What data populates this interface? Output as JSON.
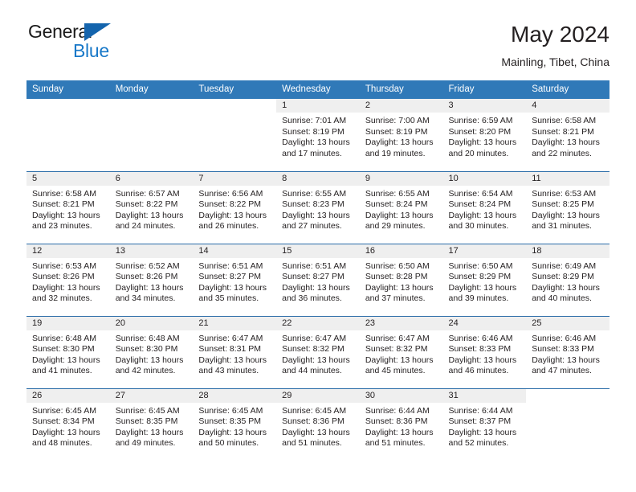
{
  "brand": {
    "name_top": "General",
    "name_bottom": "Blue",
    "color_dark": "#1a1a1a",
    "color_blue": "#1878c8",
    "triangle_color": "#1464ad"
  },
  "header": {
    "title": "May 2024",
    "subtitle": "Mainling, Tibet, China"
  },
  "theme": {
    "header_bg": "#3079b8",
    "row_divider": "#2a6ca8",
    "daynum_band_bg": "#efefef",
    "text": "#231f20"
  },
  "weekday_headers": [
    "Sunday",
    "Monday",
    "Tuesday",
    "Wednesday",
    "Thursday",
    "Friday",
    "Saturday"
  ],
  "labels": {
    "sunrise_prefix": "Sunrise:",
    "sunset_prefix": "Sunset:",
    "daylight_prefix": "Daylight:"
  },
  "weeks": [
    [
      {
        "day": "",
        "empty": true
      },
      {
        "day": "",
        "empty": true
      },
      {
        "day": "",
        "empty": true
      },
      {
        "day": "1",
        "sunrise": "Sunrise: 7:01 AM",
        "sunset": "Sunset: 8:19 PM",
        "daylight_l1": "Daylight: 13 hours",
        "daylight_l2": "and 17 minutes."
      },
      {
        "day": "2",
        "sunrise": "Sunrise: 7:00 AM",
        "sunset": "Sunset: 8:19 PM",
        "daylight_l1": "Daylight: 13 hours",
        "daylight_l2": "and 19 minutes."
      },
      {
        "day": "3",
        "sunrise": "Sunrise: 6:59 AM",
        "sunset": "Sunset: 8:20 PM",
        "daylight_l1": "Daylight: 13 hours",
        "daylight_l2": "and 20 minutes."
      },
      {
        "day": "4",
        "sunrise": "Sunrise: 6:58 AM",
        "sunset": "Sunset: 8:21 PM",
        "daylight_l1": "Daylight: 13 hours",
        "daylight_l2": "and 22 minutes."
      }
    ],
    [
      {
        "day": "5",
        "sunrise": "Sunrise: 6:58 AM",
        "sunset": "Sunset: 8:21 PM",
        "daylight_l1": "Daylight: 13 hours",
        "daylight_l2": "and 23 minutes."
      },
      {
        "day": "6",
        "sunrise": "Sunrise: 6:57 AM",
        "sunset": "Sunset: 8:22 PM",
        "daylight_l1": "Daylight: 13 hours",
        "daylight_l2": "and 24 minutes."
      },
      {
        "day": "7",
        "sunrise": "Sunrise: 6:56 AM",
        "sunset": "Sunset: 8:22 PM",
        "daylight_l1": "Daylight: 13 hours",
        "daylight_l2": "and 26 minutes."
      },
      {
        "day": "8",
        "sunrise": "Sunrise: 6:55 AM",
        "sunset": "Sunset: 8:23 PM",
        "daylight_l1": "Daylight: 13 hours",
        "daylight_l2": "and 27 minutes."
      },
      {
        "day": "9",
        "sunrise": "Sunrise: 6:55 AM",
        "sunset": "Sunset: 8:24 PM",
        "daylight_l1": "Daylight: 13 hours",
        "daylight_l2": "and 29 minutes."
      },
      {
        "day": "10",
        "sunrise": "Sunrise: 6:54 AM",
        "sunset": "Sunset: 8:24 PM",
        "daylight_l1": "Daylight: 13 hours",
        "daylight_l2": "and 30 minutes."
      },
      {
        "day": "11",
        "sunrise": "Sunrise: 6:53 AM",
        "sunset": "Sunset: 8:25 PM",
        "daylight_l1": "Daylight: 13 hours",
        "daylight_l2": "and 31 minutes."
      }
    ],
    [
      {
        "day": "12",
        "sunrise": "Sunrise: 6:53 AM",
        "sunset": "Sunset: 8:26 PM",
        "daylight_l1": "Daylight: 13 hours",
        "daylight_l2": "and 32 minutes."
      },
      {
        "day": "13",
        "sunrise": "Sunrise: 6:52 AM",
        "sunset": "Sunset: 8:26 PM",
        "daylight_l1": "Daylight: 13 hours",
        "daylight_l2": "and 34 minutes."
      },
      {
        "day": "14",
        "sunrise": "Sunrise: 6:51 AM",
        "sunset": "Sunset: 8:27 PM",
        "daylight_l1": "Daylight: 13 hours",
        "daylight_l2": "and 35 minutes."
      },
      {
        "day": "15",
        "sunrise": "Sunrise: 6:51 AM",
        "sunset": "Sunset: 8:27 PM",
        "daylight_l1": "Daylight: 13 hours",
        "daylight_l2": "and 36 minutes."
      },
      {
        "day": "16",
        "sunrise": "Sunrise: 6:50 AM",
        "sunset": "Sunset: 8:28 PM",
        "daylight_l1": "Daylight: 13 hours",
        "daylight_l2": "and 37 minutes."
      },
      {
        "day": "17",
        "sunrise": "Sunrise: 6:50 AM",
        "sunset": "Sunset: 8:29 PM",
        "daylight_l1": "Daylight: 13 hours",
        "daylight_l2": "and 39 minutes."
      },
      {
        "day": "18",
        "sunrise": "Sunrise: 6:49 AM",
        "sunset": "Sunset: 8:29 PM",
        "daylight_l1": "Daylight: 13 hours",
        "daylight_l2": "and 40 minutes."
      }
    ],
    [
      {
        "day": "19",
        "sunrise": "Sunrise: 6:48 AM",
        "sunset": "Sunset: 8:30 PM",
        "daylight_l1": "Daylight: 13 hours",
        "daylight_l2": "and 41 minutes."
      },
      {
        "day": "20",
        "sunrise": "Sunrise: 6:48 AM",
        "sunset": "Sunset: 8:30 PM",
        "daylight_l1": "Daylight: 13 hours",
        "daylight_l2": "and 42 minutes."
      },
      {
        "day": "21",
        "sunrise": "Sunrise: 6:47 AM",
        "sunset": "Sunset: 8:31 PM",
        "daylight_l1": "Daylight: 13 hours",
        "daylight_l2": "and 43 minutes."
      },
      {
        "day": "22",
        "sunrise": "Sunrise: 6:47 AM",
        "sunset": "Sunset: 8:32 PM",
        "daylight_l1": "Daylight: 13 hours",
        "daylight_l2": "and 44 minutes."
      },
      {
        "day": "23",
        "sunrise": "Sunrise: 6:47 AM",
        "sunset": "Sunset: 8:32 PM",
        "daylight_l1": "Daylight: 13 hours",
        "daylight_l2": "and 45 minutes."
      },
      {
        "day": "24",
        "sunrise": "Sunrise: 6:46 AM",
        "sunset": "Sunset: 8:33 PM",
        "daylight_l1": "Daylight: 13 hours",
        "daylight_l2": "and 46 minutes."
      },
      {
        "day": "25",
        "sunrise": "Sunrise: 6:46 AM",
        "sunset": "Sunset: 8:33 PM",
        "daylight_l1": "Daylight: 13 hours",
        "daylight_l2": "and 47 minutes."
      }
    ],
    [
      {
        "day": "26",
        "sunrise": "Sunrise: 6:45 AM",
        "sunset": "Sunset: 8:34 PM",
        "daylight_l1": "Daylight: 13 hours",
        "daylight_l2": "and 48 minutes."
      },
      {
        "day": "27",
        "sunrise": "Sunrise: 6:45 AM",
        "sunset": "Sunset: 8:35 PM",
        "daylight_l1": "Daylight: 13 hours",
        "daylight_l2": "and 49 minutes."
      },
      {
        "day": "28",
        "sunrise": "Sunrise: 6:45 AM",
        "sunset": "Sunset: 8:35 PM",
        "daylight_l1": "Daylight: 13 hours",
        "daylight_l2": "and 50 minutes."
      },
      {
        "day": "29",
        "sunrise": "Sunrise: 6:45 AM",
        "sunset": "Sunset: 8:36 PM",
        "daylight_l1": "Daylight: 13 hours",
        "daylight_l2": "and 51 minutes."
      },
      {
        "day": "30",
        "sunrise": "Sunrise: 6:44 AM",
        "sunset": "Sunset: 8:36 PM",
        "daylight_l1": "Daylight: 13 hours",
        "daylight_l2": "and 51 minutes."
      },
      {
        "day": "31",
        "sunrise": "Sunrise: 6:44 AM",
        "sunset": "Sunset: 8:37 PM",
        "daylight_l1": "Daylight: 13 hours",
        "daylight_l2": "and 52 minutes."
      },
      {
        "day": "",
        "empty": true
      }
    ]
  ]
}
